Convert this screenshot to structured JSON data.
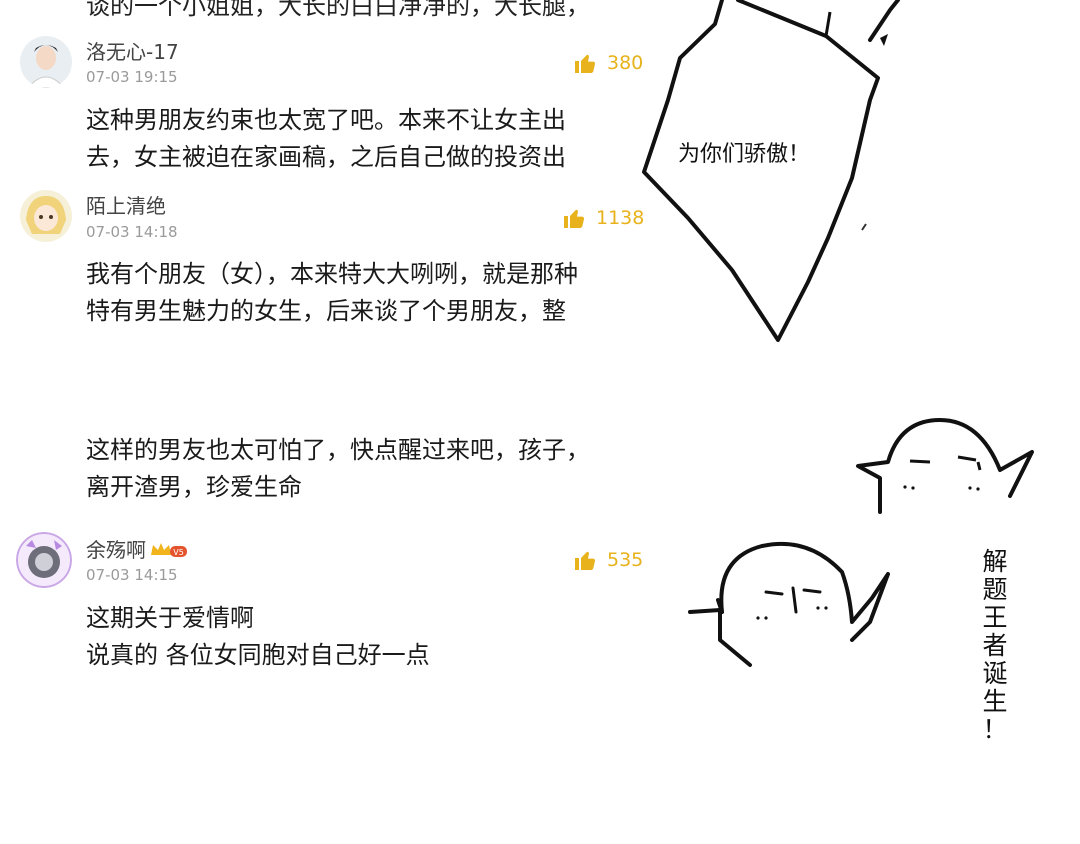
{
  "top_cut_text": "谈的一个小姐姐，大长的白白净净的，大长腿，",
  "comments": [
    {
      "username": "洛无心-17",
      "date": "07-03 19:15",
      "likes": "380",
      "lines": [
        "这种男朋友约束也太宽了吧。本来不让女主出",
        "去，女主被迫在家画稿，之后自己做的投资出"
      ]
    },
    {
      "username": "陌上清绝",
      "date": "07-03 14:18",
      "likes": "1138",
      "lines": [
        "我有个朋友（女），本来特大大咧咧，就是那种",
        "特有男生魅力的女生，后来谈了个男朋友，整"
      ]
    },
    {
      "username": "",
      "date": "",
      "likes": "",
      "lines": [
        "这样的男友也太可怕了，快点醒过来吧，孩子，",
        "离开渣男，珍爱生命"
      ]
    },
    {
      "username": "余殇啊",
      "vip_badge": "V5",
      "date": "07-03 14:15",
      "likes": "535",
      "lines": [
        "这期关于爱情啊",
        "说真的 各位女同胞对自己好一点"
      ]
    }
  ],
  "doodle": {
    "bubble_text": "为你们骄傲！",
    "vertical_text": [
      "解",
      "题",
      "王",
      "者",
      "诞",
      "生",
      "！"
    ]
  },
  "colors": {
    "like": "#e7b21b",
    "username": "#444444",
    "date": "#9a9a9a",
    "body": "#1a1a1a"
  },
  "icons": [
    "thumbs-up-icon",
    "crown-icon"
  ]
}
